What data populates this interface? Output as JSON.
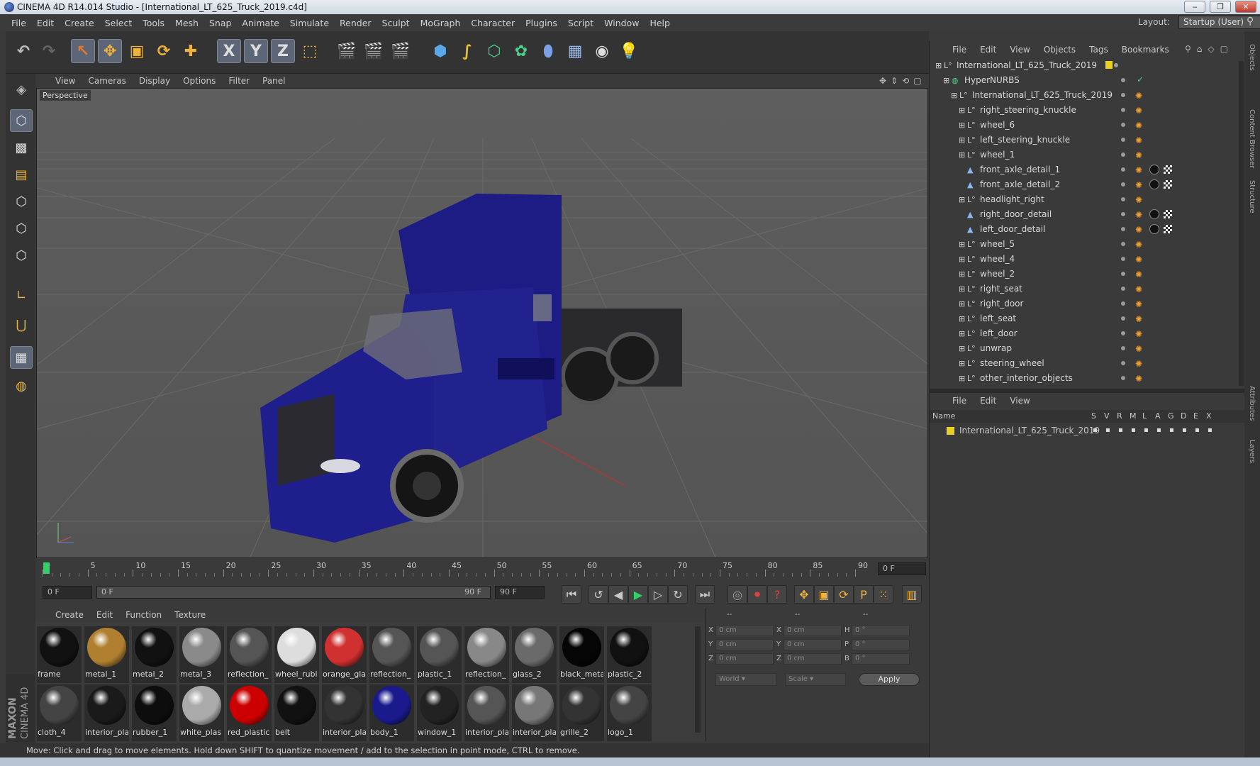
{
  "window": {
    "title": "CINEMA 4D R14.014 Studio - [International_LT_625_Truck_2019.c4d]",
    "min": "‒",
    "max": "❐",
    "close": "✕"
  },
  "menu": [
    "File",
    "Edit",
    "Create",
    "Select",
    "Tools",
    "Mesh",
    "Snap",
    "Animate",
    "Simulate",
    "Render",
    "Sculpt",
    "MoGraph",
    "Character",
    "Plugins",
    "Script",
    "Window",
    "Help"
  ],
  "layout": {
    "label": "Layout:",
    "value": "Startup (User)"
  },
  "toolbar": {
    "x_label": "X",
    "y_label": "Y",
    "z_label": "Z"
  },
  "viewport": {
    "menu": [
      "View",
      "Cameras",
      "Display",
      "Options",
      "Filter",
      "Panel"
    ],
    "label": "Perspective",
    "truck_color": "#1e1e8c"
  },
  "timeline": {
    "ticks": [
      "0",
      "5",
      "10",
      "15",
      "20",
      "25",
      "30",
      "35",
      "40",
      "45",
      "50",
      "55",
      "60",
      "65",
      "70",
      "75",
      "80",
      "85",
      "90"
    ],
    "current_frame": "0 F",
    "start": "0 F",
    "slider_start": "0 F",
    "slider_end": "90 F",
    "end": "90 F"
  },
  "materials": {
    "menu": [
      "Create",
      "Edit",
      "Function",
      "Texture"
    ],
    "row1": [
      {
        "name": "frame",
        "color": "#111"
      },
      {
        "name": "metal_1",
        "color": "#b08030"
      },
      {
        "name": "metal_2",
        "color": "#111"
      },
      {
        "name": "metal_3",
        "color": "#8a8a8a"
      },
      {
        "name": "reflection_",
        "color": "#555"
      },
      {
        "name": "wheel_rubl",
        "color": "#ddd"
      },
      {
        "name": "orange_gla",
        "color": "#d03030"
      },
      {
        "name": "reflection_",
        "color": "#555"
      },
      {
        "name": "plastic_1",
        "color": "#555"
      },
      {
        "name": "reflection_",
        "color": "#888"
      },
      {
        "name": "glass_2",
        "color": "#6a6a6a"
      },
      {
        "name": "black_meta",
        "color": "#050505"
      },
      {
        "name": "plastic_2",
        "color": "#111"
      }
    ],
    "row2": [
      {
        "name": "cloth_4",
        "color": "#444"
      },
      {
        "name": "interior_pla",
        "color": "#1a1a1a"
      },
      {
        "name": "rubber_1",
        "color": "#0d0d0d"
      },
      {
        "name": "white_plas",
        "color": "#aaa"
      },
      {
        "name": "red_plastic",
        "color": "#c00"
      },
      {
        "name": "belt",
        "color": "#111"
      },
      {
        "name": "interior_pla",
        "color": "#333"
      },
      {
        "name": "body_1",
        "color": "#1a1a8c"
      },
      {
        "name": "window_1",
        "color": "#222"
      },
      {
        "name": "interior_pla",
        "color": "#555"
      },
      {
        "name": "interior_pla",
        "color": "#777"
      },
      {
        "name": "grille_2",
        "color": "#333"
      },
      {
        "name": "logo_1",
        "color": "#444"
      }
    ]
  },
  "coords": {
    "head": [
      "--",
      "--",
      "--"
    ],
    "rows": [
      {
        "a": "X",
        "av": "0 cm",
        "b": "X",
        "bv": "0 cm",
        "c": "H",
        "cv": "0 °"
      },
      {
        "a": "Y",
        "av": "0 cm",
        "b": "Y",
        "bv": "0 cm",
        "c": "P",
        "cv": "0 °"
      },
      {
        "a": "Z",
        "av": "0 cm",
        "b": "Z",
        "bv": "0 cm",
        "c": "B",
        "cv": "0 °"
      }
    ],
    "world": "World",
    "scale": "Scale",
    "apply": "Apply"
  },
  "status": "Move: Click and drag to move elements. Hold down SHIFT to quantize movement / add to the selection in point mode, CTRL to remove.",
  "objects": {
    "menu": [
      "File",
      "Edit",
      "View",
      "Objects",
      "Tags",
      "Bookmarks"
    ],
    "items": [
      {
        "name": "International_LT_625_Truck_2019",
        "indent": 0,
        "type": "null"
      },
      {
        "name": "HyperNURBS",
        "indent": 1,
        "type": "nurbs"
      },
      {
        "name": "International_LT_625_Truck_2019",
        "indent": 2,
        "type": "null"
      },
      {
        "name": "right_steering_knuckle",
        "indent": 3,
        "type": "null"
      },
      {
        "name": "wheel_6",
        "indent": 3,
        "type": "null"
      },
      {
        "name": "left_steering_knuckle",
        "indent": 3,
        "type": "null"
      },
      {
        "name": "wheel_1",
        "indent": 3,
        "type": "null"
      },
      {
        "name": "front_axle_detail_1",
        "indent": 3,
        "type": "poly"
      },
      {
        "name": "front_axle_detail_2",
        "indent": 3,
        "type": "poly"
      },
      {
        "name": "headlight_right",
        "indent": 3,
        "type": "null"
      },
      {
        "name": "right_door_detail",
        "indent": 3,
        "type": "poly"
      },
      {
        "name": "left_door_detail",
        "indent": 3,
        "type": "poly"
      },
      {
        "name": "wheel_5",
        "indent": 3,
        "type": "null"
      },
      {
        "name": "wheel_4",
        "indent": 3,
        "type": "null"
      },
      {
        "name": "wheel_2",
        "indent": 3,
        "type": "null"
      },
      {
        "name": "right_seat",
        "indent": 3,
        "type": "null"
      },
      {
        "name": "right_door",
        "indent": 3,
        "type": "null"
      },
      {
        "name": "left_seat",
        "indent": 3,
        "type": "null"
      },
      {
        "name": "left_door",
        "indent": 3,
        "type": "null"
      },
      {
        "name": "unwrap",
        "indent": 3,
        "type": "null"
      },
      {
        "name": "steering_wheel",
        "indent": 3,
        "type": "null"
      },
      {
        "name": "other_interior_objects",
        "indent": 3,
        "type": "null"
      }
    ]
  },
  "layers": {
    "menu": [
      "File",
      "Edit",
      "View"
    ],
    "headers": {
      "name": "Name",
      "cols": [
        "S",
        "V",
        "R",
        "M",
        "L",
        "A",
        "G",
        "D",
        "E",
        "X"
      ]
    },
    "items": [
      {
        "name": "International_LT_625_Truck_2019",
        "color": "#e8d020"
      }
    ]
  },
  "side_tabs": [
    "Objects",
    "Content Browser",
    "Structure",
    "Attributes",
    "Layers"
  ]
}
